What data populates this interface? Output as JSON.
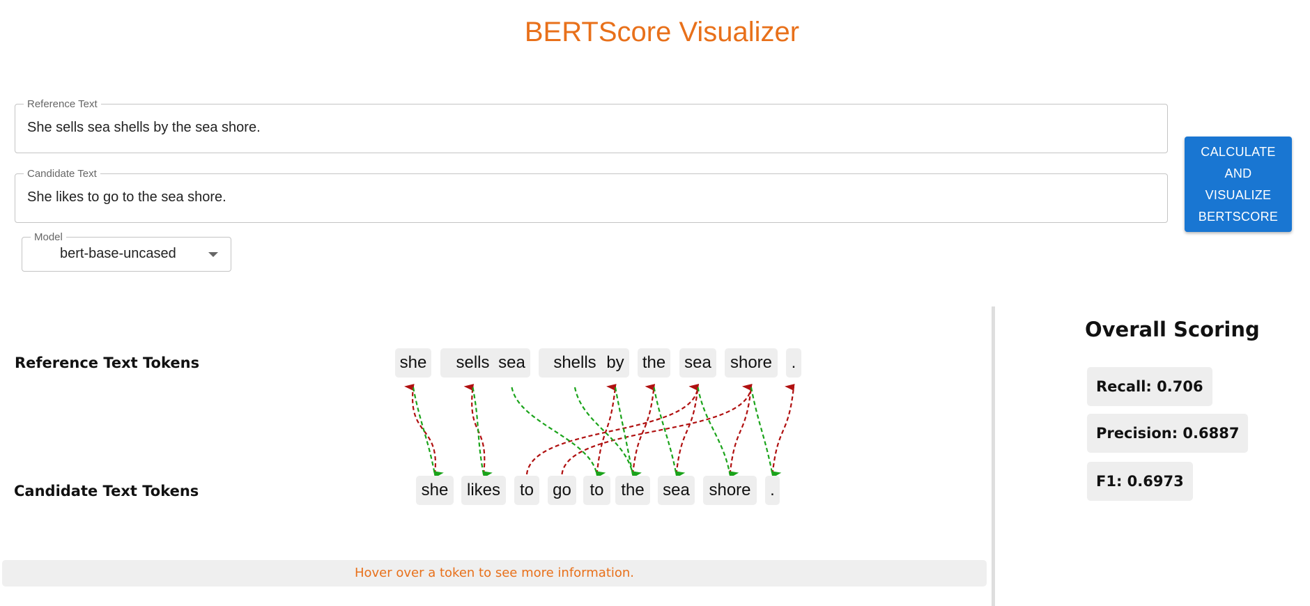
{
  "title": "BERTScore Visualizer",
  "reference_field": {
    "label": "Reference Text",
    "value": "She sells sea shells by the sea shore."
  },
  "candidate_field": {
    "label": "Candidate Text",
    "value": "She likes to go to the sea shore."
  },
  "model_field": {
    "label": "Model",
    "value": "bert-base-uncased"
  },
  "calculate_button": "CALCULATE AND VISUALIZE BERTSCORE",
  "reference_tokens_label": "Reference Text Tokens",
  "candidate_tokens_label": "Candidate Text Tokens",
  "reference_tokens": [
    "she",
    "sells",
    "sea",
    "shells",
    "by",
    "the",
    "sea",
    "shore",
    "."
  ],
  "candidate_tokens": [
    "she",
    "likes",
    "to",
    "go",
    "to",
    "the",
    "sea",
    "shore",
    "."
  ],
  "recall_matches": [
    0,
    1,
    6,
    7,
    4,
    5,
    6,
    7,
    8
  ],
  "precision_matches": [
    0,
    1,
    4,
    5,
    5,
    6,
    7,
    8
  ],
  "colors": {
    "recall_arrow": "#b01010",
    "precision_arrow": "#1aa31a",
    "accent": "#e8701a",
    "button": "#1976d2"
  },
  "hover_hint": "Hover over a token to see more information.",
  "scoring": {
    "title": "Overall Scoring",
    "recall": "Recall: 0.706",
    "precision": "Precision: 0.6887",
    "f1": "F1: 0.6973"
  }
}
